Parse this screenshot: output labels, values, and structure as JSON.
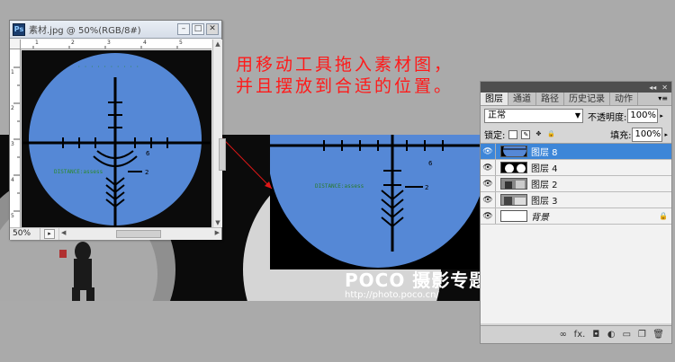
{
  "document": {
    "title": "素材.jpg @ 50%(RGB/8#)",
    "app_icon": "Ps",
    "zoom": "50%",
    "ruler_top_marks": [
      "1",
      "2",
      "3",
      "4",
      "5"
    ],
    "ruler_left_marks": [
      "1",
      "2",
      "3",
      "4",
      "5"
    ]
  },
  "annotation": {
    "line1": "用移动工具拖入素材图，",
    "line2": "并且摆放到合适的位置。"
  },
  "watermark": {
    "main": "POCO 摄影专题",
    "url": "http://photo.poco.cn/"
  },
  "layers_panel": {
    "tabs": [
      "图层",
      "通道",
      "路径",
      "历史记录",
      "动作"
    ],
    "active_tab": "图层",
    "blend_mode": "正常",
    "opacity_label": "不透明度:",
    "opacity_value": "100%",
    "lock_label": "锁定:",
    "fill_label": "填充:",
    "fill_value": "100%",
    "layers": [
      {
        "name": "图层 8",
        "selected": true,
        "thumb": "scope"
      },
      {
        "name": "图层 4",
        "selected": false,
        "thumb": "circles"
      },
      {
        "name": "图层 2",
        "selected": false,
        "thumb": "photo"
      },
      {
        "name": "图层 3",
        "selected": false,
        "thumb": "photo"
      },
      {
        "name": "背景",
        "selected": false,
        "thumb": "blank",
        "locked": true
      }
    ],
    "footer_icons": [
      "link-icon",
      "fx-icon",
      "mask-icon",
      "adjustment-icon",
      "group-icon",
      "new-layer-icon",
      "trash-icon"
    ],
    "footer_glyphs": [
      "∞",
      "fx.",
      "◘",
      "◐",
      "▭",
      "❐",
      "🗑"
    ]
  },
  "colors": {
    "scope_blue": "#5588d6",
    "annotation_red": "#ff1a1a",
    "selected_layer": "#3d86d8"
  }
}
